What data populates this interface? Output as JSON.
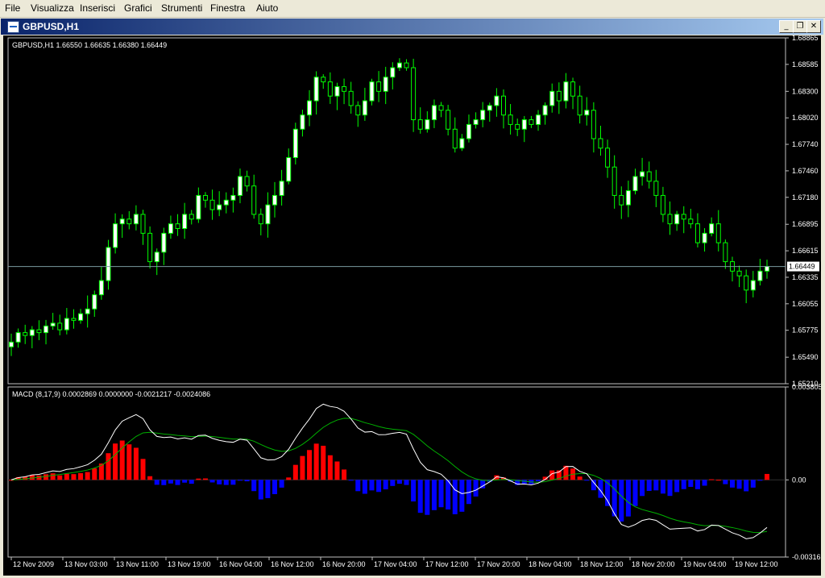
{
  "menu": [
    "File",
    "Visualizza",
    "Inserisci",
    "Grafici",
    "Strumenti",
    "Finestra",
    "Aiuto"
  ],
  "window": {
    "title": "GBPUSD,H1",
    "buttons": {
      "minimize": "_",
      "restore": "❐",
      "close": "✕"
    }
  },
  "colors": {
    "bull": "#ffffff",
    "bear": "#000000",
    "wick": "#00ff00",
    "hist_pos": "#ff0000",
    "hist_neg": "#0000ff",
    "macd": "#ffffff",
    "signal": "#00b000",
    "bid_line": "#7a9aa0"
  },
  "chart_data": [
    {
      "type": "candlestick",
      "symbol_label": "GBPUSD,H1",
      "ohlc_label": "1.66550 1.66635 1.66380 1.66449",
      "ylim": [
        1.6521,
        1.68865
      ],
      "y_ticks": [
        "1.68865",
        "1.68585",
        "1.68300",
        "1.68020",
        "1.67740",
        "1.67460",
        "1.67180",
        "1.66895",
        "1.66615",
        "1.66335",
        "1.66055",
        "1.65775",
        "1.65490",
        "1.65210"
      ],
      "current_price": 1.66449,
      "current_price_label": "1.66449",
      "x_ticks": [
        "12 Nov 2009",
        "13 Nov 03:00",
        "13 Nov 11:00",
        "13 Nov 19:00",
        "16 Nov 04:00",
        "16 Nov 12:00",
        "16 Nov 20:00",
        "17 Nov 04:00",
        "17 Nov 12:00",
        "17 Nov 20:00",
        "18 Nov 04:00",
        "18 Nov 12:00",
        "18 Nov 20:00",
        "19 Nov 04:00",
        "19 Nov 12:00"
      ],
      "close": [
        1.6565,
        1.6575,
        1.6572,
        1.6578,
        1.6575,
        1.6582,
        1.6585,
        1.6578,
        1.659,
        1.6588,
        1.6595,
        1.66,
        1.6615,
        1.663,
        1.6665,
        1.669,
        1.6695,
        1.669,
        1.67,
        1.668,
        1.665,
        1.666,
        1.668,
        1.669,
        1.6685,
        1.67,
        1.6695,
        1.672,
        1.6715,
        1.6705,
        1.671,
        1.6715,
        1.672,
        1.674,
        1.673,
        1.67,
        1.669,
        1.671,
        1.672,
        1.6735,
        1.676,
        1.679,
        1.6805,
        1.682,
        1.6845,
        1.684,
        1.6825,
        1.6835,
        1.683,
        1.6815,
        1.6805,
        1.682,
        1.684,
        1.683,
        1.6845,
        1.6855,
        1.686,
        1.6855,
        1.68,
        1.679,
        1.68,
        1.6815,
        1.681,
        1.679,
        1.677,
        1.678,
        1.6795,
        1.68,
        1.681,
        1.6815,
        1.6825,
        1.6805,
        1.6795,
        1.679,
        1.68,
        1.6795,
        1.6805,
        1.6815,
        1.683,
        1.682,
        1.684,
        1.6825,
        1.6805,
        1.681,
        1.678,
        1.677,
        1.675,
        1.672,
        1.671,
        1.6725,
        1.674,
        1.6745,
        1.6735,
        1.672,
        1.67,
        1.669,
        1.67,
        1.6695,
        1.669,
        1.667,
        1.668,
        1.669,
        1.667,
        1.665,
        1.664,
        1.6635,
        1.662,
        1.663,
        1.664,
        1.6645
      ],
      "volatility_note": ""
    },
    {
      "type": "macd",
      "label": "MACD",
      "params_label": "(8,17,9) 0.0002869 0.0000000 -0.0021217 -0.0024086",
      "ylim": [
        -0.00316,
        0.003805
      ],
      "y_ticks": [
        "0.003805",
        "0.00",
        "-0.00316"
      ]
    }
  ]
}
